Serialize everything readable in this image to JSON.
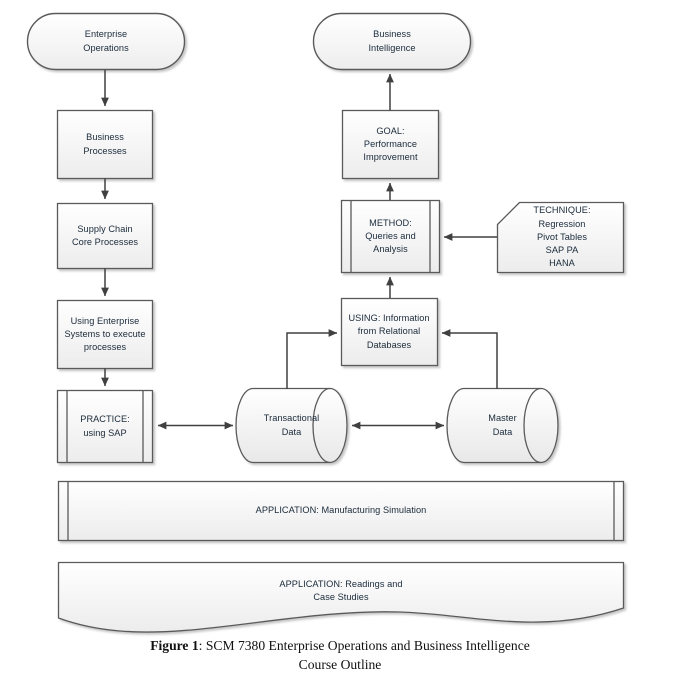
{
  "figure": {
    "label_bold": "Figure 1",
    "caption_line1_rest": ": SCM 7380 Enterprise Operations and Business Intelligence",
    "caption_line2": "Course Outline"
  },
  "nodes": {
    "enterprise_operations": {
      "label": "Enterprise\nOperations",
      "shape": "rounded-terminator"
    },
    "business_intelligence": {
      "label": "Business\nIntelligence",
      "shape": "rounded-terminator"
    },
    "business_processes": {
      "label": "Business\nProcesses",
      "shape": "rectangle"
    },
    "supply_chain_core_processes": {
      "label": "Supply Chain\nCore Processes",
      "shape": "rectangle"
    },
    "using_enterprise_systems": {
      "label": "Using Enterprise\nSystems to execute\nprocesses",
      "shape": "rectangle"
    },
    "practice_using_sap": {
      "label": "PRACTICE:\nusing SAP",
      "shape": "predefined-process"
    },
    "goal_performance_improvement": {
      "label": "GOAL:\nPerformance\nImprovement",
      "shape": "rectangle"
    },
    "method_queries_analysis": {
      "label": "METHOD:\nQueries and\nAnalysis",
      "shape": "predefined-process"
    },
    "technique": {
      "label": "TECHNIQUE:\nRegression\nPivot Tables\nSAP PA\nHANA",
      "shape": "cut-corner-card"
    },
    "using_information_relational_databases": {
      "label": "USING: Information\nfrom Relational\nDatabases",
      "shape": "rectangle"
    },
    "transactional_data": {
      "label": "Transactional\nData",
      "shape": "horizontal-cylinder"
    },
    "master_data": {
      "label": "Master\nData",
      "shape": "horizontal-cylinder"
    },
    "application_manufacturing_simulation": {
      "label": "APPLICATION: Manufacturing Simulation",
      "shape": "predefined-process-banner"
    },
    "application_readings_case_studies": {
      "label": "APPLICATION: Readings and\nCase Studies",
      "shape": "document-banner"
    }
  },
  "colors": {
    "stroke": "#595959",
    "stroke_dark": "#404040",
    "fill_top": "#ffffff",
    "fill_bottom": "#efefef",
    "text": "#1a2a3a",
    "arrow": "#404040",
    "caption_text": "#111111"
  },
  "connectors": [
    {
      "name": "enterprise-operations-to-business-processes",
      "from": "enterprise_operations",
      "to": "business_processes",
      "type": "arrow-down"
    },
    {
      "name": "business-processes-to-supply-chain",
      "from": "business_processes",
      "to": "supply_chain_core_processes",
      "type": "arrow-down"
    },
    {
      "name": "supply-chain-to-using-enterprise-systems",
      "from": "supply_chain_core_processes",
      "to": "using_enterprise_systems",
      "type": "arrow-down"
    },
    {
      "name": "using-enterprise-systems-to-practice",
      "from": "using_enterprise_systems",
      "to": "practice_using_sap",
      "type": "arrow-down"
    },
    {
      "name": "practice-to-transactional-data",
      "from": "practice_using_sap",
      "to": "transactional_data",
      "type": "double-arrow-horizontal"
    },
    {
      "name": "transactional-data-to-master-data",
      "from": "transactional_data",
      "to": "master_data",
      "type": "double-arrow-horizontal"
    },
    {
      "name": "transactional-data-to-using-information",
      "from": "transactional_data",
      "to": "using_information_relational_databases",
      "type": "elbow-arrow"
    },
    {
      "name": "master-data-to-using-information",
      "from": "master_data",
      "to": "using_information_relational_databases",
      "type": "elbow-arrow"
    },
    {
      "name": "using-information-to-method",
      "from": "using_information_relational_databases",
      "to": "method_queries_analysis",
      "type": "arrow-up"
    },
    {
      "name": "technique-to-method",
      "from": "technique",
      "to": "method_queries_analysis",
      "type": "arrow-left"
    },
    {
      "name": "method-to-goal",
      "from": "method_queries_analysis",
      "to": "goal_performance_improvement",
      "type": "arrow-up"
    },
    {
      "name": "goal-to-business-intelligence",
      "from": "goal_performance_improvement",
      "to": "business_intelligence",
      "type": "arrow-up"
    }
  ]
}
